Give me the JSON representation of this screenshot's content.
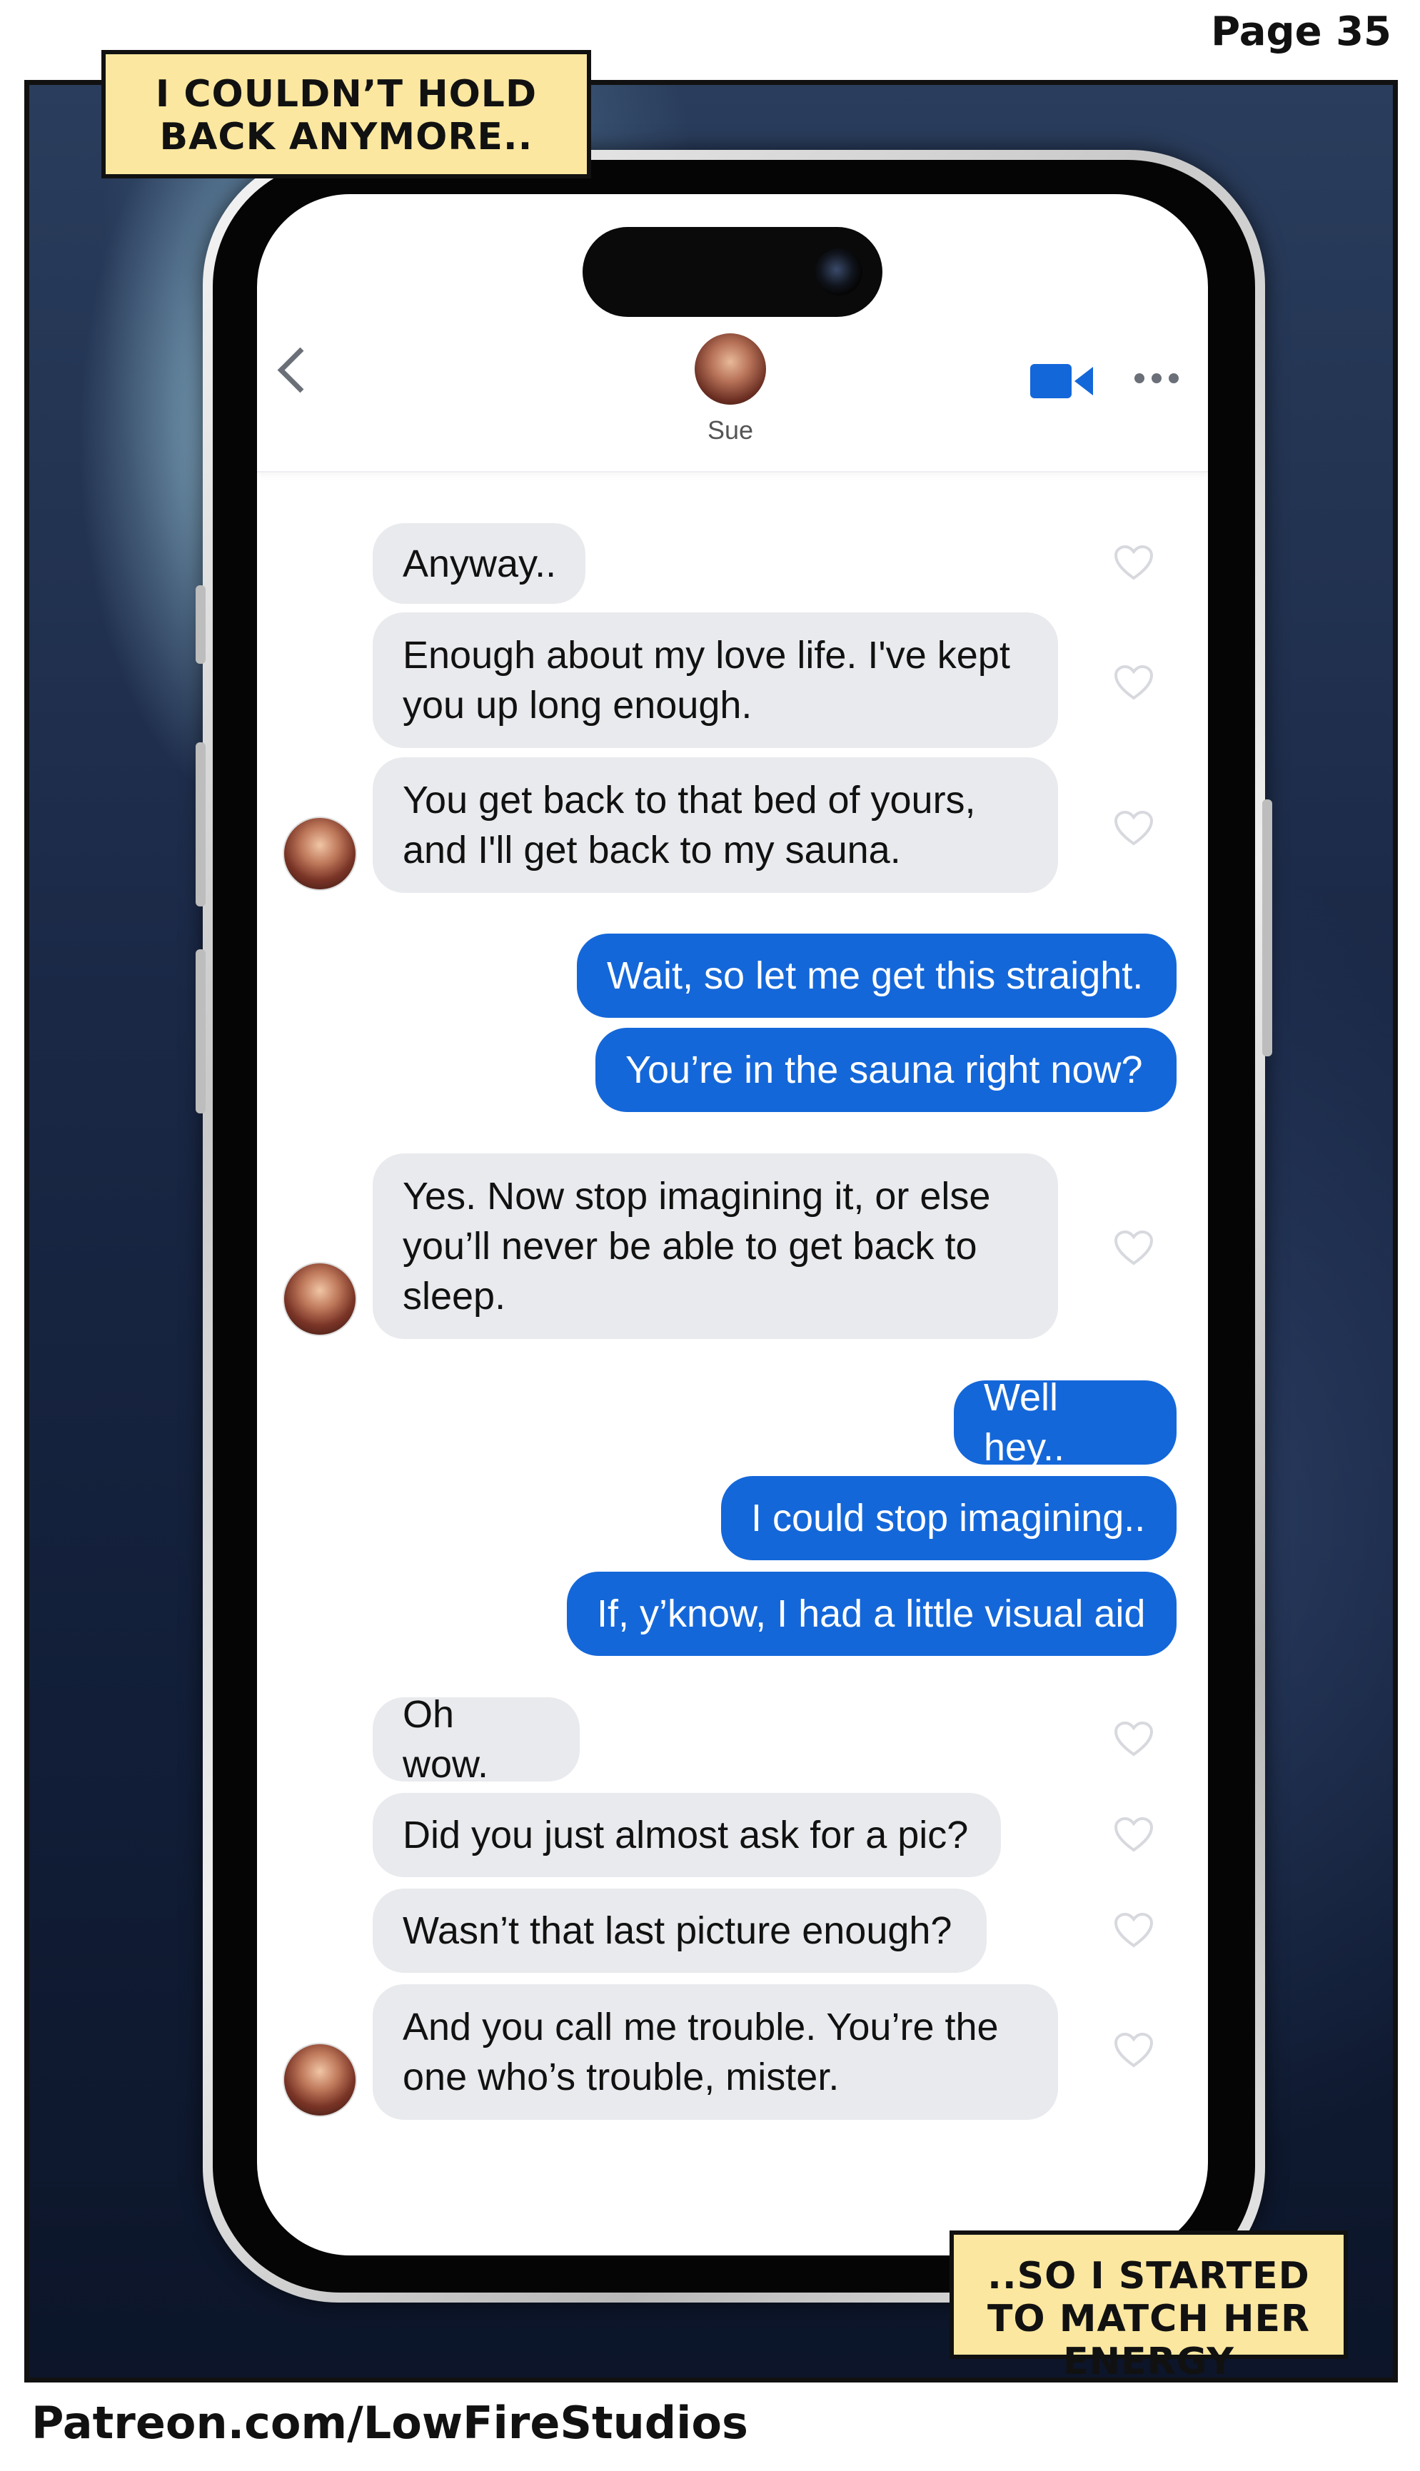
{
  "page_number": "Page 35",
  "captions": {
    "top": "I COULDN’T HOLD BACK ANYMORE..",
    "bottom": "..SO I STARTED TO MATCH HER ENERGY"
  },
  "chat_header": {
    "contact_name": "Sue",
    "back_icon": "chevron-left-icon",
    "video_icon": "video-camera-icon",
    "more_icon": "more-dots-icon",
    "accent_color": "#1467d9"
  },
  "messages": [
    {
      "direction": "in",
      "text": "Anyway.."
    },
    {
      "direction": "in",
      "text": "Enough about my love life. I've kept you up long enough."
    },
    {
      "direction": "in",
      "text": "You get back to that bed of yours, and I'll get back to my sauna."
    },
    {
      "direction": "out",
      "text": "Wait, so let me get this straight."
    },
    {
      "direction": "out",
      "text": "You’re in the sauna right now?"
    },
    {
      "direction": "in",
      "text": "Yes. Now stop imagining it, or else you’ll never be able to get back to sleep."
    },
    {
      "direction": "out",
      "text": "Well hey.."
    },
    {
      "direction": "out",
      "text": "I could stop imagining.."
    },
    {
      "direction": "out",
      "text": "If, y’know, I had a little visual aid"
    },
    {
      "direction": "in",
      "text": "Oh wow."
    },
    {
      "direction": "in",
      "text": "Did you just almost ask for a pic?"
    },
    {
      "direction": "in",
      "text": "Wasn’t that last picture enough?"
    },
    {
      "direction": "in",
      "text": "And you call me trouble. You’re the one who’s trouble, mister."
    }
  ],
  "footer": {
    "link": "Patreon.com/LowFireStudios"
  }
}
